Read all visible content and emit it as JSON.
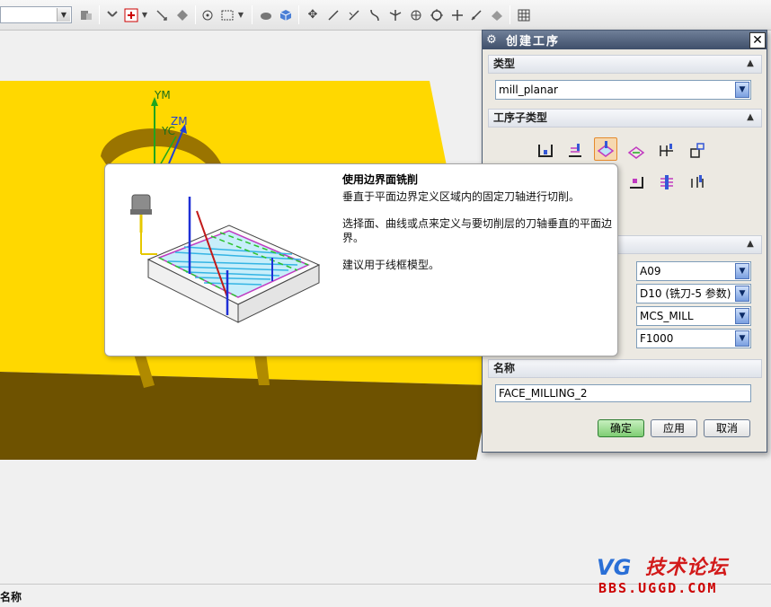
{
  "toolbar": {
    "icons": [
      "snap-icon",
      "dynamic-rotate-icon",
      "selection-filter-icon",
      "move-icon",
      "point-icon",
      "rectangle-select-icon",
      "shaded-icon",
      "3d-box-icon",
      "move-handle-icon",
      "line-icon",
      "arc-icon",
      "curve-icon",
      "intersection-icon",
      "circle-point-icon",
      "circle-icon",
      "cross-icon",
      "measure-icon",
      "layer-icon"
    ]
  },
  "viewport": {
    "axes": {
      "ym": "YM",
      "zm": "ZM",
      "yc": "YC"
    }
  },
  "statusbar": {
    "label": "名称"
  },
  "dialog": {
    "title": "创建工序",
    "sections": {
      "type": {
        "header": "类型",
        "value": "mill_planar"
      },
      "subtype": {
        "header": "工序子类型"
      },
      "location": {
        "program": "A09",
        "tool": "D10 (铣刀-5 参数)",
        "geometry": "MCS_MILL",
        "method": "F1000"
      },
      "name": {
        "header": "名称",
        "value": "FACE_MILLING_2"
      }
    },
    "buttons": {
      "ok": "确定",
      "apply": "应用",
      "cancel": "取消"
    }
  },
  "tooltip": {
    "title": "使用边界面铣削",
    "line1": "垂直于平面边界定义区域内的固定刀轴进行切削。",
    "line2a": "选择面、曲线或点来定义与要切削层的刀轴垂直的平面边",
    "line2b": "界。",
    "line3": "建议用于线框模型。"
  },
  "watermark": {
    "cn": "技术论坛",
    "en": "BBS.UGGD.COM",
    "logo": "VG"
  },
  "colors": {
    "part_yellow": "#ffd800",
    "part_shadow": "#6e5200",
    "dialog_title": "#4a5a72",
    "ok_button": "#7fcd73"
  }
}
